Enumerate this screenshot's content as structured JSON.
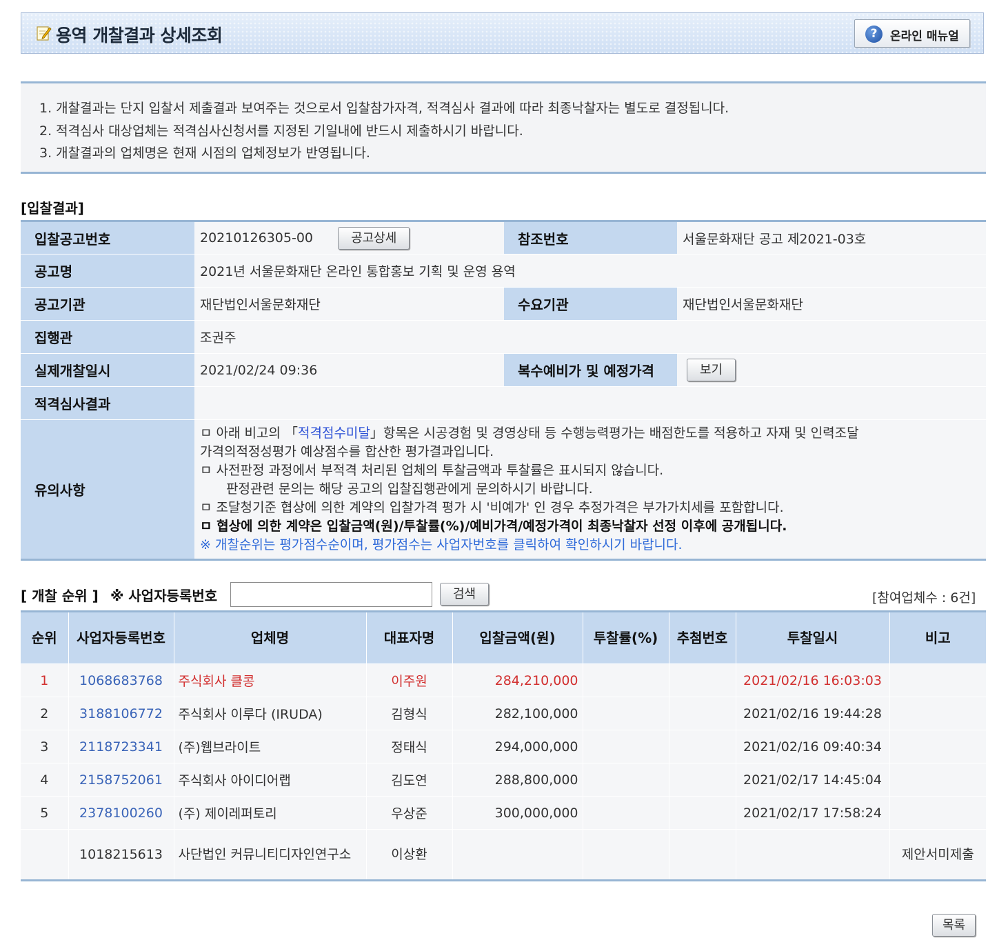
{
  "page": {
    "title": "용역 개찰결과 상세조회",
    "manual_label": "온라인 매뉴얼",
    "manual_icon": "question-icon"
  },
  "notices": [
    "1. 개찰결과는 단지 입찰서 제출결과 보여주는 것으로서 입찰참가자격, 적격심사 결과에 따라 최종낙찰자는 별도로 결정됩니다.",
    "2. 적격심사 대상업체는 적격심사신청서를 지정된 기일내에 반드시 제출하시기 바랍니다.",
    "3. 개찰결과의 업체명은 현재 시점의 업체정보가 반영됩니다."
  ],
  "bid_result": {
    "section_title": "[입찰결과]",
    "notice_no_label": "입찰공고번호",
    "notice_no": "20210126305-00",
    "notice_detail_btn": "공고상세",
    "ref_no_label": "참조번호",
    "ref_no": "서울문화재단 공고 제2021-03호",
    "notice_name_label": "공고명",
    "notice_name": "2021년 서울문화재단 온라인 통합홍보 기획 및 운영 용역",
    "agency_label": "공고기관",
    "agency": "재단법인서울문화재단",
    "demand_label": "수요기관",
    "demand": "재단법인서울문화재단",
    "executor_label": "집행관",
    "executor": "조권주",
    "open_date_label": "실제개찰일시",
    "open_date": "2021/02/24 09:36",
    "price_label": "복수예비가 및 예정가격",
    "view_btn": "보기",
    "exam_label": "적격심사결과",
    "exam_value": "",
    "caution_label": "유의사항",
    "caution": {
      "l1a": "ㅁ 아래 비고의 「",
      "l1b": "적격점수미달",
      "l1c": "」항목은 시공경험 및 경영상태 등 수행능력평가는 배점한도를 적용하고 자재 및 인력조달",
      "l2": "가격의적정성평가 예상점수를 합산한 평가결과입니다.",
      "l3": "ㅁ 사전판정 과정에서 부적격 처리된 업체의 투찰금액과 투찰률은 표시되지 않습니다.",
      "l4": "판정관련 문의는 해당 공고의 입찰집행관에게 문의하시기 바랍니다.",
      "l5": "ㅁ 조달청기준 협상에 의한 계약의 입찰가격 평가 시 '비예가' 인 경우 추정가격은 부가가치세를 포함합니다.",
      "l6": "ㅁ 협상에 의한 계약은 입찰금액(원)/투찰률(%)/예비가격/예정가격이 최종낙찰자 선정 이후에 공개됩니다.",
      "l7": "※ 개찰순위는 평가점수순이며, 평가점수는 사업자번호를 클릭하여 확인하시기 바랍니다."
    }
  },
  "ranking": {
    "title": "[ 개찰 순위 ]",
    "biz_label": "※ 사업자등록번호",
    "biz_value": "",
    "search_btn": "검색",
    "count": "[참여업체수 : 6건]",
    "headers": [
      "순위",
      "사업자등록번호",
      "업체명",
      "대표자명",
      "입찰금액(원)",
      "투찰률(%)",
      "추첨번호",
      "투찰일시",
      "비고"
    ],
    "rows": [
      {
        "rank": "1",
        "biz_no": "1068683768",
        "company": "주식회사 클콩",
        "ceo": "이주원",
        "amount": "284,210,000",
        "rate": "",
        "draw": "",
        "date": "2021/02/16 16:03:03",
        "remark": ""
      },
      {
        "rank": "2",
        "biz_no": "3188106772",
        "company": "주식회사 이루다 (IRUDA)",
        "ceo": "김형식",
        "amount": "282,100,000",
        "rate": "",
        "draw": "",
        "date": "2021/02/16 19:44:28",
        "remark": ""
      },
      {
        "rank": "3",
        "biz_no": "2118723341",
        "company": "(주)웹브라이트",
        "ceo": "정태식",
        "amount": "294,000,000",
        "rate": "",
        "draw": "",
        "date": "2021/02/16 09:40:34",
        "remark": ""
      },
      {
        "rank": "4",
        "biz_no": "2158752061",
        "company": "주식회사 아이디어랩",
        "ceo": "김도연",
        "amount": "288,800,000",
        "rate": "",
        "draw": "",
        "date": "2021/02/17 14:45:04",
        "remark": ""
      },
      {
        "rank": "5",
        "biz_no": "2378100260",
        "company": "(주) 제이레퍼토리",
        "ceo": "우상준",
        "amount": "300,000,000",
        "rate": "",
        "draw": "",
        "date": "2021/02/17 17:58:24",
        "remark": ""
      },
      {
        "rank": "",
        "biz_no": "1018215613",
        "company": "사단법인 커뮤니티디자인연구소",
        "ceo": "이상환",
        "amount": "",
        "rate": "",
        "draw": "",
        "date": "",
        "remark": "제안서미제출"
      }
    ]
  },
  "footer": {
    "list_btn": "목록"
  },
  "colors": {
    "header_bg": "#c4d8ef",
    "border": "#97b5d4",
    "winner": "#d23030",
    "link": "#3a64b8"
  }
}
